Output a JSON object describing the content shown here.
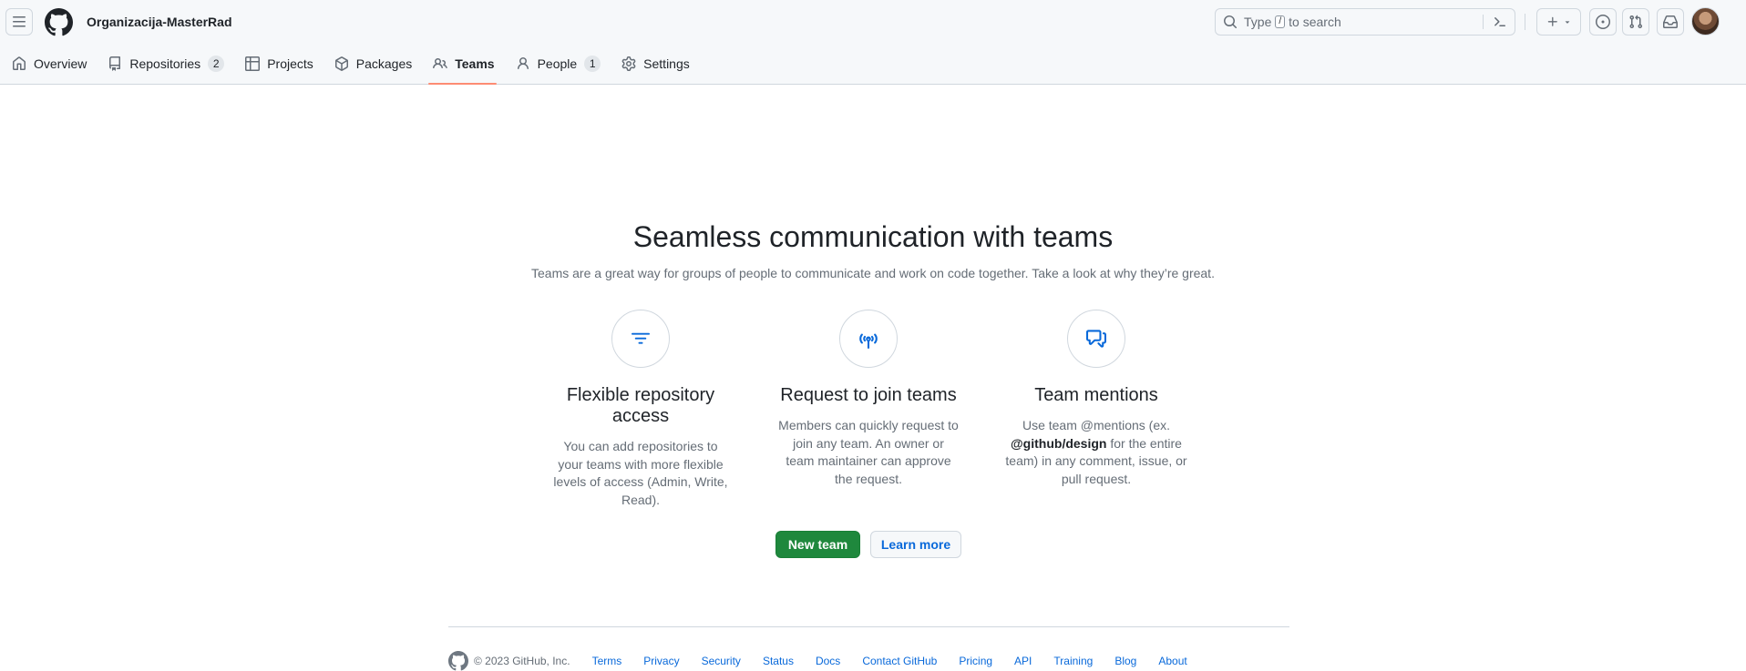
{
  "header": {
    "org_name": "Organizacija-MasterRad",
    "search_placeholder_pre": "Type",
    "search_key": "/",
    "search_placeholder_post": "to search",
    "avatar_alt": "user avatar"
  },
  "tabs": [
    {
      "label": "Overview",
      "icon": "home-icon"
    },
    {
      "label": "Repositories",
      "count": "2",
      "icon": "repo-icon"
    },
    {
      "label": "Projects",
      "icon": "table-icon"
    },
    {
      "label": "Packages",
      "icon": "package-icon"
    },
    {
      "label": "Teams",
      "icon": "people-icon",
      "selected": true
    },
    {
      "label": "People",
      "count": "1",
      "icon": "person-icon"
    },
    {
      "label": "Settings",
      "icon": "gear-icon"
    }
  ],
  "hero": {
    "title": "Seamless communication with teams",
    "subtitle": "Teams are a great way for groups of people to communicate and work on code together. Take a look at why they’re great."
  },
  "features": [
    {
      "title": "Flexible repository access",
      "text": "You can add repositories to your teams with more flexible levels of access (Admin, Write, Read)."
    },
    {
      "title": "Request to join teams",
      "text": "Members can quickly request to join any team. An owner or team maintainer can approve the request."
    },
    {
      "title": "Team mentions",
      "text_pre": "Use team @mentions (ex.",
      "text_bold": "@github/design",
      "text_post": "for the entire team) in any comment, issue, or pull request."
    }
  ],
  "actions": {
    "new_team": "New team",
    "learn_more": "Learn more"
  },
  "footer": {
    "copyright": "© 2023 GitHub, Inc.",
    "links": [
      "Terms",
      "Privacy",
      "Security",
      "Status",
      "Docs",
      "Contact GitHub",
      "Pricing",
      "API",
      "Training",
      "Blog",
      "About"
    ]
  },
  "colors": {
    "accent_green": "#1f883d",
    "link_blue": "#0969da",
    "tab_underline": "#fd8c73"
  }
}
